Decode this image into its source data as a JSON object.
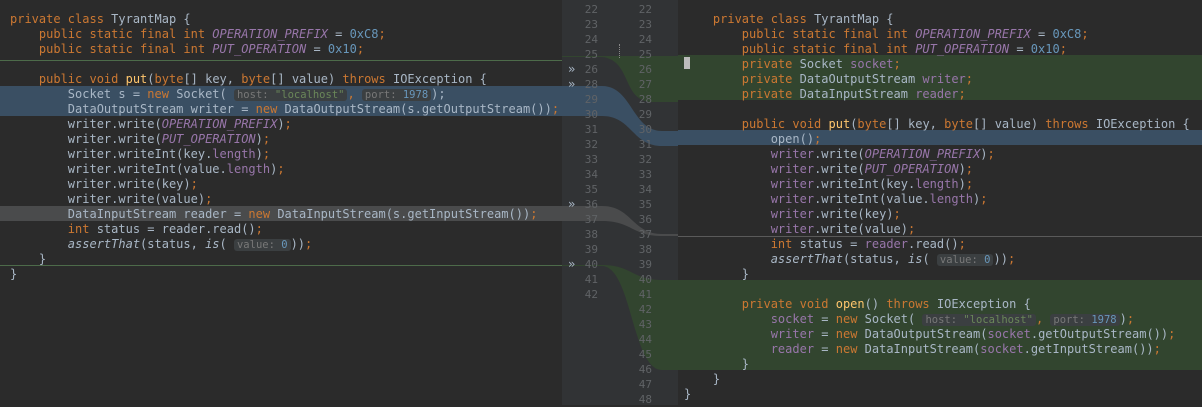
{
  "left_lines": [
    {
      "text": "private class TyrantMap {",
      "spans": [
        [
          "kw",
          "private class "
        ],
        [
          "",
          "TyrantMap {"
        ]
      ]
    },
    {
      "text": "    public static final int OPERATION_PREFIX = 0xC8;",
      "spans": [
        [
          "",
          "    "
        ],
        [
          "kw",
          "public static final int "
        ],
        [
          "const",
          "OPERATION_PREFIX"
        ],
        [
          "",
          " = "
        ],
        [
          "num",
          "0xC8"
        ],
        [
          "kw",
          ";"
        ]
      ]
    },
    {
      "text": "    public static final int PUT_OPERATION = 0x10;",
      "spans": [
        [
          "",
          "    "
        ],
        [
          "kw",
          "public static final int "
        ],
        [
          "const",
          "PUT_OPERATION"
        ],
        [
          "",
          " = "
        ],
        [
          "num",
          "0x10"
        ],
        [
          "kw",
          ";"
        ]
      ]
    },
    {
      "text": "",
      "spans": []
    },
    {
      "text": "    public void put(byte[] key, byte[] value) throws IOException {",
      "spans": [
        [
          "",
          "    "
        ],
        [
          "kw",
          "public void "
        ],
        [
          "fn",
          "put"
        ],
        [
          "",
          "("
        ],
        [
          "kw",
          "byte"
        ],
        [
          "",
          "[] key, "
        ],
        [
          "kw",
          "byte"
        ],
        [
          "",
          "[] value) "
        ],
        [
          "kw",
          "throws "
        ],
        [
          "",
          "IOException {"
        ]
      ]
    },
    {
      "text": "        Socket s = new Socket(",
      "spans": [
        [
          "",
          "        Socket s = "
        ],
        [
          "kw",
          "new "
        ],
        [
          "",
          "Socket( "
        ],
        [
          "hint-host",
          ""
        ],
        [
          "kw",
          ", "
        ],
        [
          "hint-port",
          ""
        ],
        [
          "",
          "); "
        ]
      ]
    },
    {
      "text": "        DataOutputStream writer = new DataOutputStream(s.getOutputStream());",
      "spans": [
        [
          "",
          "        DataOutputStream writer = "
        ],
        [
          "kw",
          "new "
        ],
        [
          "",
          "DataOutputStream(s.getOutputStream())"
        ],
        [
          "kw",
          ";"
        ]
      ]
    },
    {
      "text": "        writer.write(OPERATION_PREFIX);",
      "spans": [
        [
          "",
          "        writer.write("
        ],
        [
          "const",
          "OPERATION_PREFIX"
        ],
        [
          "",
          ")"
        ],
        [
          "kw",
          ";"
        ]
      ]
    },
    {
      "text": "        writer.write(PUT_OPERATION);",
      "spans": [
        [
          "",
          "        writer.write("
        ],
        [
          "const",
          "PUT_OPERATION"
        ],
        [
          "",
          ")"
        ],
        [
          "kw",
          ";"
        ]
      ]
    },
    {
      "text": "        writer.writeInt(key.length);",
      "spans": [
        [
          "",
          "        writer.writeInt(key."
        ],
        [
          "field",
          "length"
        ],
        [
          "",
          ")"
        ],
        [
          "kw",
          ";"
        ]
      ]
    },
    {
      "text": "        writer.writeInt(value.length);",
      "spans": [
        [
          "",
          "        writer.writeInt(value."
        ],
        [
          "field",
          "length"
        ],
        [
          "",
          ")"
        ],
        [
          "kw",
          ";"
        ]
      ]
    },
    {
      "text": "        writer.write(key);",
      "spans": [
        [
          "",
          "        writer.write(key)"
        ],
        [
          "kw",
          ";"
        ]
      ]
    },
    {
      "text": "        writer.write(value);",
      "spans": [
        [
          "",
          "        writer.write(value)"
        ],
        [
          "kw",
          ";"
        ]
      ]
    },
    {
      "text": "        DataInputStream reader = new DataInputStream(s.getInputStream());",
      "spans": [
        [
          "",
          "        DataInputStream reader = "
        ],
        [
          "kw",
          "new "
        ],
        [
          "",
          "DataInputStream(s.getInputStream())"
        ],
        [
          "kw",
          ";"
        ]
      ]
    },
    {
      "text": "        int status = reader.read();",
      "spans": [
        [
          "",
          "        "
        ],
        [
          "kw",
          "int "
        ],
        [
          "",
          "status = reader.read()"
        ],
        [
          "kw",
          ";"
        ]
      ]
    },
    {
      "text": "        assertThat(status, is(",
      "spans": [
        [
          "",
          "        "
        ],
        [
          "it",
          "assertThat"
        ],
        [
          "",
          "(status, "
        ],
        [
          "it",
          "is"
        ],
        [
          "",
          "( "
        ],
        [
          "hint-value",
          ""
        ],
        [
          "",
          "))"
        ],
        [
          "kw",
          ";"
        ]
      ]
    },
    {
      "text": "    }",
      "spans": [
        [
          "",
          "    }"
        ]
      ]
    },
    {
      "text": "}",
      "spans": [
        [
          "",
          "}"
        ]
      ]
    }
  ],
  "right_lines": [
    {
      "spans": [
        [
          "",
          "    "
        ],
        [
          "kw",
          "private class "
        ],
        [
          "",
          "TyrantMap {"
        ]
      ]
    },
    {
      "spans": [
        [
          "",
          "        "
        ],
        [
          "kw",
          "public static final int "
        ],
        [
          "const",
          "OPERATION_PREFIX"
        ],
        [
          "",
          " = "
        ],
        [
          "num",
          "0xC8"
        ],
        [
          "kw",
          ";"
        ]
      ]
    },
    {
      "spans": [
        [
          "",
          "        "
        ],
        [
          "kw",
          "public static final int "
        ],
        [
          "const",
          "PUT_OPERATION"
        ],
        [
          "",
          " = "
        ],
        [
          "num",
          "0x10"
        ],
        [
          "kw",
          ";"
        ]
      ]
    },
    {
      "spans": [
        [
          "",
          "        "
        ],
        [
          "kw",
          "private "
        ],
        [
          "",
          "Socket "
        ],
        [
          "field",
          "socket"
        ],
        [
          "kw",
          ";"
        ]
      ]
    },
    {
      "spans": [
        [
          "",
          "        "
        ],
        [
          "kw",
          "private "
        ],
        [
          "",
          "DataOutputStream "
        ],
        [
          "field",
          "writer"
        ],
        [
          "kw",
          ";"
        ]
      ]
    },
    {
      "spans": [
        [
          "",
          "        "
        ],
        [
          "kw",
          "private "
        ],
        [
          "",
          "DataInputStream "
        ],
        [
          "field",
          "reader"
        ],
        [
          "kw",
          ";"
        ]
      ]
    },
    {
      "spans": []
    },
    {
      "spans": [
        [
          "",
          "        "
        ],
        [
          "kw",
          "public void "
        ],
        [
          "fn",
          "put"
        ],
        [
          "",
          "("
        ],
        [
          "kw",
          "byte"
        ],
        [
          "",
          "[] key, "
        ],
        [
          "kw",
          "byte"
        ],
        [
          "",
          "[] value) "
        ],
        [
          "kw",
          "throws "
        ],
        [
          "",
          "IOException {"
        ]
      ]
    },
    {
      "spans": [
        [
          "",
          "            open()"
        ],
        [
          "kw",
          ";"
        ]
      ]
    },
    {
      "spans": [
        [
          "",
          "            "
        ],
        [
          "field",
          "writer"
        ],
        [
          "",
          ".write("
        ],
        [
          "const",
          "OPERATION_PREFIX"
        ],
        [
          "",
          ")"
        ],
        [
          "kw",
          ";"
        ]
      ]
    },
    {
      "spans": [
        [
          "",
          "            "
        ],
        [
          "field",
          "writer"
        ],
        [
          "",
          ".write("
        ],
        [
          "const",
          "PUT_OPERATION"
        ],
        [
          "",
          ")"
        ],
        [
          "kw",
          ";"
        ]
      ]
    },
    {
      "spans": [
        [
          "",
          "            "
        ],
        [
          "field",
          "writer"
        ],
        [
          "",
          ".writeInt(key."
        ],
        [
          "field",
          "length"
        ],
        [
          "",
          ")"
        ],
        [
          "kw",
          ";"
        ]
      ]
    },
    {
      "spans": [
        [
          "",
          "            "
        ],
        [
          "field",
          "writer"
        ],
        [
          "",
          ".writeInt(value."
        ],
        [
          "field",
          "length"
        ],
        [
          "",
          ")"
        ],
        [
          "kw",
          ";"
        ]
      ]
    },
    {
      "spans": [
        [
          "",
          "            "
        ],
        [
          "field",
          "writer"
        ],
        [
          "",
          ".write(key)"
        ],
        [
          "kw",
          ";"
        ]
      ]
    },
    {
      "spans": [
        [
          "",
          "            "
        ],
        [
          "field",
          "writer"
        ],
        [
          "",
          ".write(value)"
        ],
        [
          "kw",
          ";"
        ]
      ]
    },
    {
      "spans": [
        [
          "",
          "            "
        ],
        [
          "kw",
          "int "
        ],
        [
          "",
          "status = "
        ],
        [
          "field",
          "reader"
        ],
        [
          "",
          ".read()"
        ],
        [
          "kw",
          ";"
        ]
      ]
    },
    {
      "spans": [
        [
          "",
          "            "
        ],
        [
          "it",
          "assertThat"
        ],
        [
          "",
          "(status, "
        ],
        [
          "it",
          "is"
        ],
        [
          "",
          "( "
        ],
        [
          "hint-value",
          ""
        ],
        [
          "",
          "))"
        ],
        [
          "kw",
          ";"
        ]
      ]
    },
    {
      "spans": [
        [
          "",
          "        }"
        ]
      ]
    },
    {
      "spans": []
    },
    {
      "spans": [
        [
          "",
          "        "
        ],
        [
          "kw",
          "private void "
        ],
        [
          "fn",
          "open"
        ],
        [
          "",
          "() "
        ],
        [
          "kw",
          "throws "
        ],
        [
          "",
          "IOException {"
        ]
      ]
    },
    {
      "spans": [
        [
          "",
          "            "
        ],
        [
          "field",
          "socket"
        ],
        [
          "",
          " = "
        ],
        [
          "kw",
          "new "
        ],
        [
          "",
          "Socket( "
        ],
        [
          "hint-host",
          ""
        ],
        [
          "kw",
          ", "
        ],
        [
          "hint-port",
          ""
        ],
        [
          "",
          ")"
        ],
        [
          "kw",
          ";"
        ]
      ]
    },
    {
      "spans": [
        [
          "",
          "            "
        ],
        [
          "field",
          "writer"
        ],
        [
          "",
          " = "
        ],
        [
          "kw",
          "new "
        ],
        [
          "",
          "DataOutputStream("
        ],
        [
          "field",
          "socket"
        ],
        [
          "",
          ".getOutputStream())"
        ],
        [
          "kw",
          ";"
        ]
      ]
    },
    {
      "spans": [
        [
          "",
          "            "
        ],
        [
          "field",
          "reader"
        ],
        [
          "",
          " = "
        ],
        [
          "kw",
          "new "
        ],
        [
          "",
          "DataInputStream("
        ],
        [
          "field",
          "socket"
        ],
        [
          "",
          ".getInputStream())"
        ],
        [
          "kw",
          ";"
        ]
      ]
    },
    {
      "spans": [
        [
          "",
          "        }"
        ]
      ]
    },
    {
      "spans": [
        [
          "",
          "    }"
        ]
      ]
    },
    {
      "spans": [
        [
          "",
          "}"
        ]
      ]
    }
  ],
  "hints": {
    "host_name": "host:",
    "host_value": "\"localhost\"",
    "port_name": "port:",
    "port_value": "1978",
    "value_name": "value:",
    "value_value": "0"
  },
  "left_line_numbers": [
    "22",
    "23",
    "24",
    "25",
    "26",
    "28",
    "29",
    "30",
    "31",
    "32",
    "33",
    "34",
    "35",
    "36",
    "37",
    "38",
    "39",
    "40",
    "41",
    "42"
  ],
  "right_line_numbers": [
    "22",
    "23",
    "24",
    "25",
    "26",
    "27",
    "28",
    "29",
    "30",
    "31",
    "32",
    "33",
    "34",
    "35",
    "36",
    "37",
    "38",
    "39",
    "40",
    "41",
    "42",
    "43",
    "44",
    "45",
    "46",
    "47",
    "48"
  ],
  "markers": [
    "»",
    "»",
    "»",
    "»"
  ],
  "colors": {
    "background": "#2b2b2b",
    "changed": "#3a4f63",
    "inserted": "#32452f",
    "modified_gray": "#4a4b4c"
  }
}
